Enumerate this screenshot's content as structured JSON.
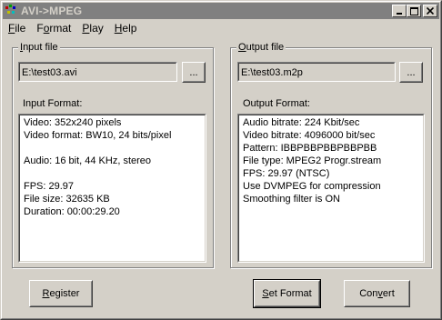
{
  "window": {
    "title": "AVI->MPEG"
  },
  "menu": {
    "file": {
      "pre": "",
      "key": "F",
      "post": "ile"
    },
    "format": {
      "pre": "F",
      "key": "o",
      "post": "rmat"
    },
    "play": {
      "pre": "",
      "key": "P",
      "post": "lay"
    },
    "help": {
      "pre": "",
      "key": "H",
      "post": "elp"
    }
  },
  "input": {
    "group_label": {
      "pre": "",
      "key": "I",
      "post": "nput file"
    },
    "path": "E:\\test03.avi",
    "browse_label": "...",
    "format_label": "Input Format:",
    "lines": [
      "Video: 352x240 pixels",
      "Video format: BW10, 24 bits/pixel",
      "",
      "Audio: 16 bit, 44 KHz, stereo",
      "",
      "FPS: 29.97",
      "File size: 32635 KB",
      "Duration: 00:00:29.20"
    ]
  },
  "output": {
    "group_label": {
      "pre": "",
      "key": "O",
      "post": "utput file"
    },
    "path": "E:\\test03.m2p",
    "browse_label": "...",
    "format_label": "Output Format:",
    "lines": [
      "Audio bitrate: 224 Kbit/sec",
      "Video bitrate: 4096000 bit/sec",
      "Pattern: IBBPBBPBBPBBPBB",
      "File type: MPEG2 Progr.stream",
      "FPS: 29.97 (NTSC)",
      "Use DVMPEG for compression",
      "Smoothing filter is ON"
    ]
  },
  "buttons": {
    "register": {
      "pre": "",
      "key": "R",
      "post": "egister"
    },
    "set_format": {
      "pre": "",
      "key": "S",
      "post": "et Format"
    },
    "convert": {
      "pre": "Con",
      "key": "v",
      "post": "ert"
    }
  }
}
